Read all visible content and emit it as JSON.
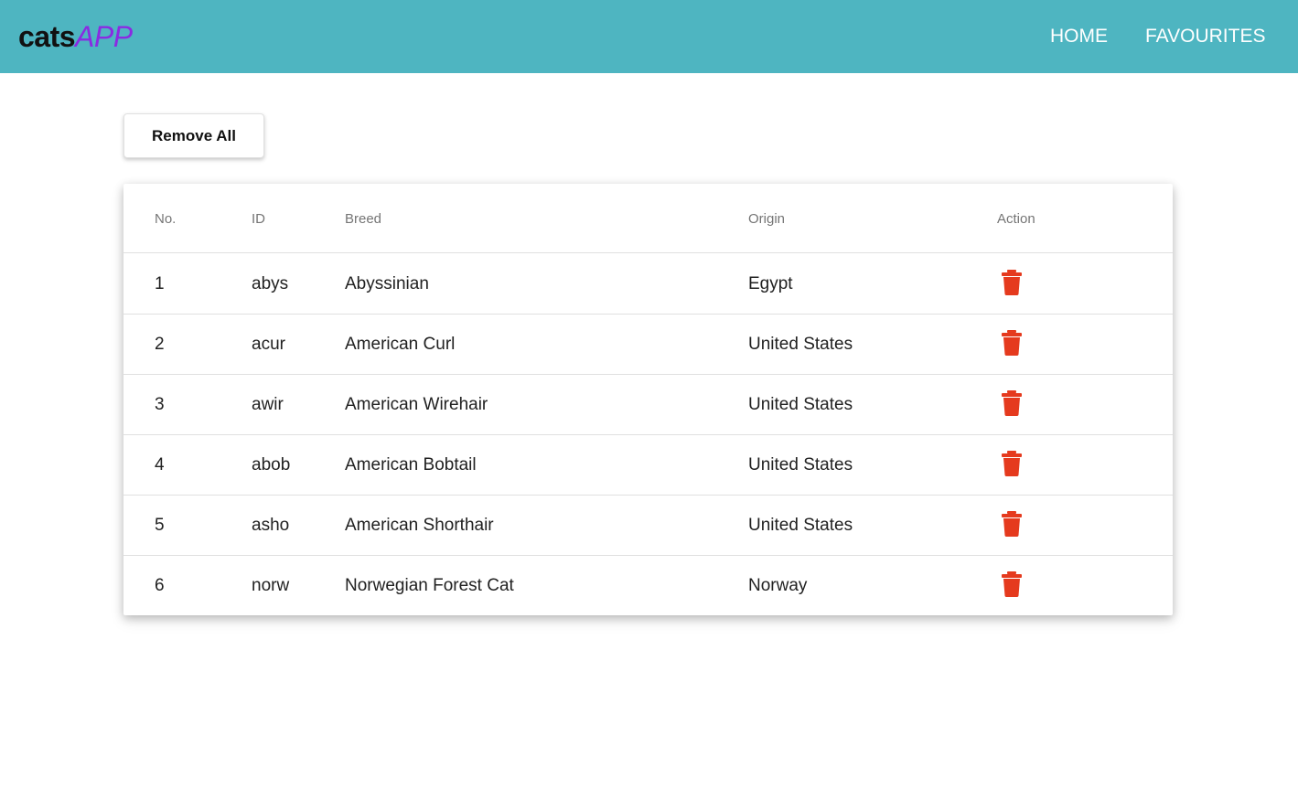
{
  "header": {
    "logo_part1": "cats",
    "logo_part2": "APP",
    "nav": [
      {
        "label": "HOME"
      },
      {
        "label": "FAVOURITES"
      }
    ],
    "bar_color": "#4eb5c1",
    "logo_accent_color": "#8a2be2"
  },
  "actions": {
    "remove_all_label": "Remove All"
  },
  "table": {
    "columns": [
      "No.",
      "ID",
      "Breed",
      "Origin",
      "Action"
    ],
    "rows": [
      {
        "no": "1",
        "id": "abys",
        "breed": "Abyssinian",
        "origin": "Egypt",
        "action_icon": "trash-icon"
      },
      {
        "no": "2",
        "id": "acur",
        "breed": "American Curl",
        "origin": "United States",
        "action_icon": "trash-icon"
      },
      {
        "no": "3",
        "id": "awir",
        "breed": "American Wirehair",
        "origin": "United States",
        "action_icon": "trash-icon"
      },
      {
        "no": "4",
        "id": "abob",
        "breed": "American Bobtail",
        "origin": "United States",
        "action_icon": "trash-icon"
      },
      {
        "no": "5",
        "id": "asho",
        "breed": "American Shorthair",
        "origin": "United States",
        "action_icon": "trash-icon"
      },
      {
        "no": "6",
        "id": "norw",
        "breed": "Norwegian Forest Cat",
        "origin": "Norway",
        "action_icon": "trash-icon"
      }
    ],
    "delete_icon_color": "#e53a1e"
  }
}
